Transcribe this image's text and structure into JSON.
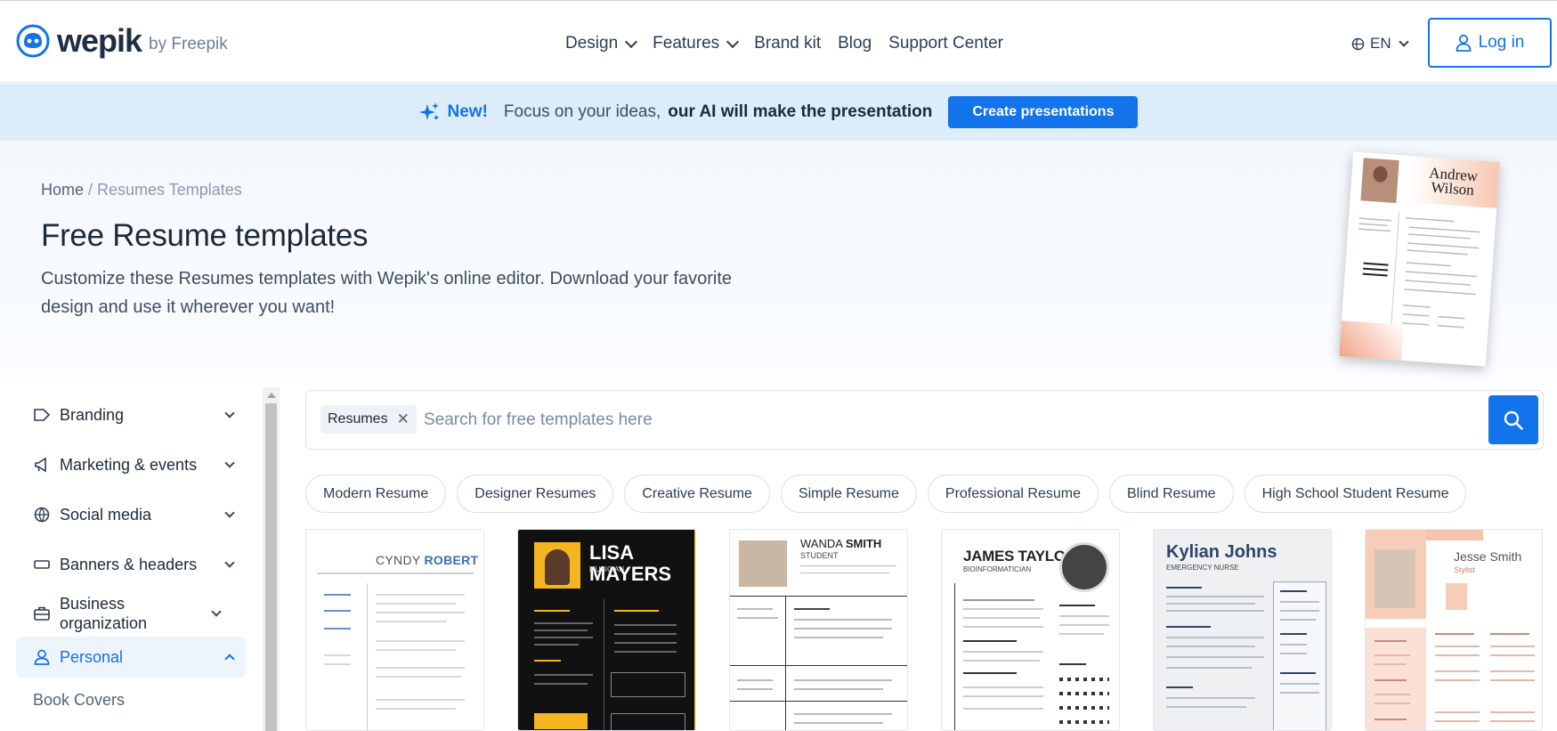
{
  "header": {
    "logo_word": "wepik",
    "logo_by": "by Freepik",
    "nav": [
      {
        "label": "Design",
        "dropdown": true
      },
      {
        "label": "Features",
        "dropdown": true
      },
      {
        "label": "Brand kit",
        "dropdown": false
      },
      {
        "label": "Blog",
        "dropdown": false
      },
      {
        "label": "Support Center",
        "dropdown": false
      }
    ],
    "language": "EN",
    "login_label": "Log in"
  },
  "promo": {
    "new_label": "New!",
    "focus_text": "Focus on your ideas,",
    "ai_text": "our AI will make the presentation",
    "cta_label": "Create presentations"
  },
  "hero": {
    "breadcrumb_home": "Home",
    "breadcrumb_sep": " / ",
    "breadcrumb_current": "Resumes Templates",
    "title": "Free Resume templates",
    "description": "Customize these Resumes templates with Wepik's online editor. Download your favorite design and use it wherever you want!",
    "image_name_first": "Andrew",
    "image_name_last": "Wilson"
  },
  "sidebar": {
    "items": [
      {
        "label": "Branding",
        "icon": "tag-icon",
        "expanded": false
      },
      {
        "label": "Marketing & events",
        "icon": "megaphone-icon",
        "expanded": false
      },
      {
        "label": "Social media",
        "icon": "globe-icon",
        "expanded": false
      },
      {
        "label": "Banners & headers",
        "icon": "banner-icon",
        "expanded": false
      },
      {
        "label": "Business organization",
        "icon": "briefcase-icon",
        "expanded": false
      },
      {
        "label": "Personal",
        "icon": "user-icon",
        "expanded": true
      }
    ],
    "sub_items": [
      "Book Covers"
    ]
  },
  "search": {
    "chip_label": "Resumes",
    "placeholder": "Search for free templates here"
  },
  "tags": [
    "Modern Resume",
    "Designer Resumes",
    "Creative Resume",
    "Simple Resume",
    "Professional Resume",
    "Blind Resume",
    "High School Student Resume"
  ],
  "cards": [
    {
      "first": "CYNDY",
      "last": "ROBERT",
      "role": ""
    },
    {
      "first": "LISA MAYERS",
      "last": "",
      "role": "MUSICIAN"
    },
    {
      "first": "WANDA",
      "last": "SMITH",
      "role": "STUDENT"
    },
    {
      "first": "JAMES TAYLOR",
      "last": "",
      "role": "BIOINFORMATICIAN"
    },
    {
      "first": "Kylian Johns",
      "last": "",
      "role": "EMERGENCY NURSE"
    },
    {
      "first": "Jesse Smith",
      "last": "",
      "role": "Stylist"
    }
  ],
  "colors": {
    "accent": "#1273eb",
    "promo_bg": "#dcedf9",
    "text": "#1d2a3a"
  }
}
